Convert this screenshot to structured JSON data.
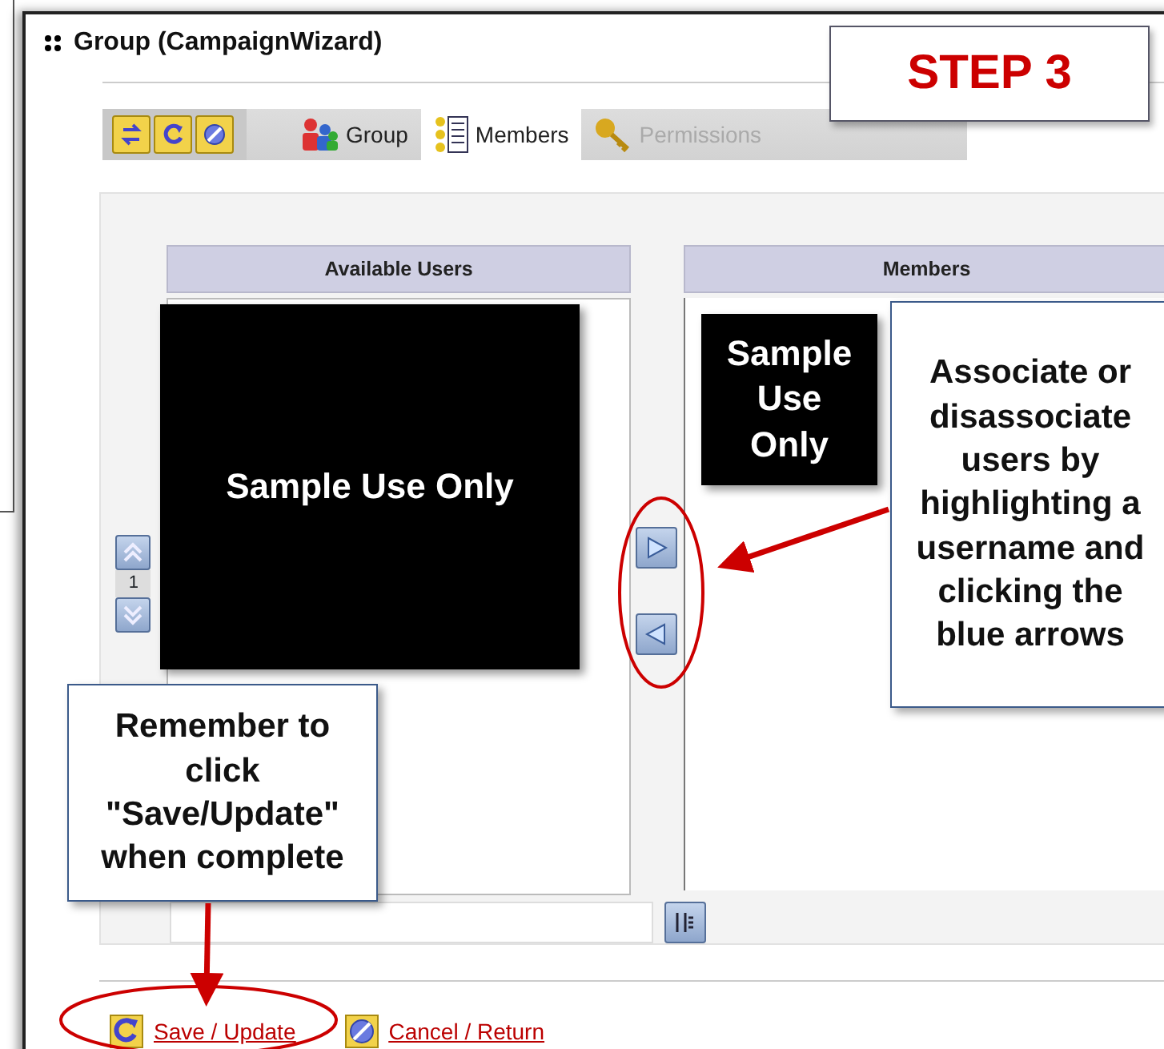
{
  "window": {
    "title": "Group (CampaignWizard)"
  },
  "tabs": [
    {
      "label": "Group",
      "selected": false,
      "disabled": false
    },
    {
      "label": "Members",
      "selected": true,
      "disabled": false
    },
    {
      "label": "Permissions",
      "selected": false,
      "disabled": true
    }
  ],
  "available_users": {
    "header": "Available Users",
    "page": "1"
  },
  "members": {
    "header": "Members"
  },
  "actions": [
    {
      "label": "Save / Update"
    },
    {
      "label": "Cancel / Return"
    }
  ],
  "annotations": [
    {
      "kind": "step",
      "text": "STEP 3"
    },
    {
      "kind": "redaction",
      "text": "Sample Use Only"
    },
    {
      "kind": "redaction",
      "text": "Sample Use Only"
    },
    {
      "kind": "callout",
      "text": "Associate or disassociate users by highlighting a username and clicking the blue arrows"
    },
    {
      "kind": "callout",
      "text": "Remember to click \"Save/Update\" when complete"
    }
  ]
}
